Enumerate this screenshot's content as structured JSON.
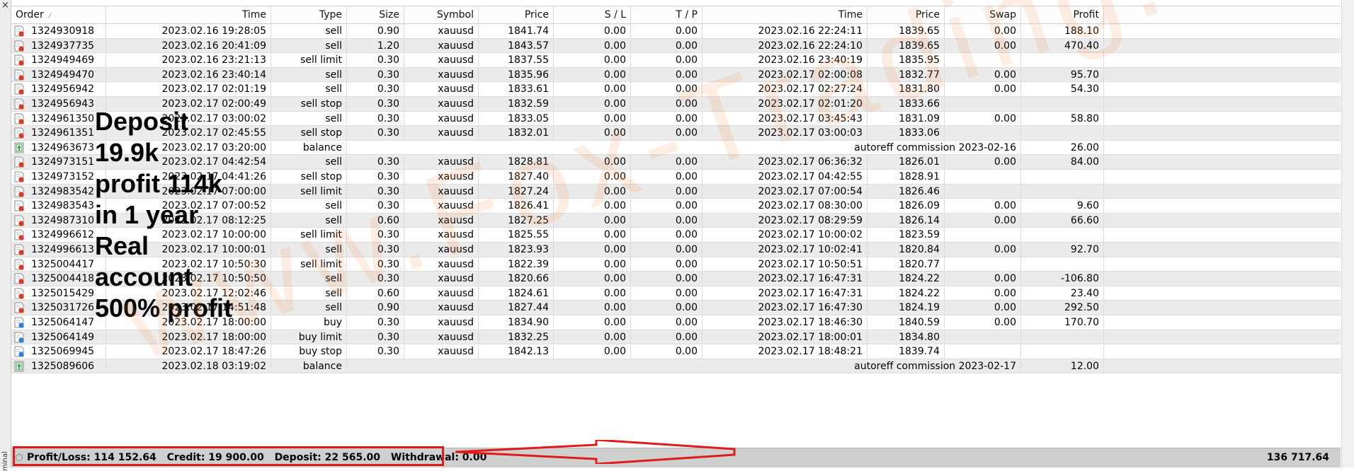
{
  "window": {
    "close_glyph": "×",
    "side_label": "minal"
  },
  "columns": [
    "Order",
    "Time",
    "Type",
    "Size",
    "Symbol",
    "Price",
    "S / L",
    "T / P",
    "Time",
    "Price",
    "Swap",
    "Profit"
  ],
  "rows": [
    {
      "order": "1324930918",
      "icon": "sell-order-icon",
      "time": "2023.02.16 19:28:05",
      "type": "sell",
      "size": "0.90",
      "symbol": "xauusd",
      "price": "1841.74",
      "sl": "0.00",
      "tp": "0.00",
      "close_time": "2023.02.16 22:24:11",
      "close_price": "1839.65",
      "swap": "0.00",
      "profit": "188.10"
    },
    {
      "order": "1324937735",
      "icon": "sell-order-icon",
      "time": "2023.02.16 20:41:09",
      "type": "sell",
      "size": "1.20",
      "symbol": "xauusd",
      "price": "1843.57",
      "sl": "0.00",
      "tp": "0.00",
      "close_time": "2023.02.16 22:24:10",
      "close_price": "1839.65",
      "swap": "0.00",
      "profit": "470.40"
    },
    {
      "order": "1324949469",
      "icon": "sell-order-icon",
      "time": "2023.02.16 23:21:13",
      "type": "sell limit",
      "size": "0.30",
      "symbol": "xauusd",
      "price": "1837.55",
      "sl": "0.00",
      "tp": "0.00",
      "close_time": "2023.02.16 23:40:19",
      "close_price": "1835.95",
      "swap": "",
      "profit": ""
    },
    {
      "order": "1324949470",
      "icon": "sell-order-icon",
      "time": "2023.02.16 23:40:14",
      "type": "sell",
      "size": "0.30",
      "symbol": "xauusd",
      "price": "1835.96",
      "sl": "0.00",
      "tp": "0.00",
      "close_time": "2023.02.17 02:00:08",
      "close_price": "1832.77",
      "swap": "0.00",
      "profit": "95.70"
    },
    {
      "order": "1324956942",
      "icon": "sell-order-icon",
      "time": "2023.02.17 02:01:19",
      "type": "sell",
      "size": "0.30",
      "symbol": "xauusd",
      "price": "1833.61",
      "sl": "0.00",
      "tp": "0.00",
      "close_time": "2023.02.17 02:27:24",
      "close_price": "1831.80",
      "swap": "0.00",
      "profit": "54.30"
    },
    {
      "order": "1324956943",
      "icon": "sell-order-icon",
      "time": "2023.02.17 02:00:49",
      "type": "sell stop",
      "size": "0.30",
      "symbol": "xauusd",
      "price": "1832.59",
      "sl": "0.00",
      "tp": "0.00",
      "close_time": "2023.02.17 02:01:20",
      "close_price": "1833.66",
      "swap": "",
      "profit": ""
    },
    {
      "order": "1324961350",
      "icon": "sell-order-icon",
      "time": "2023.02.17 03:00:02",
      "type": "sell",
      "size": "0.30",
      "symbol": "xauusd",
      "price": "1833.05",
      "sl": "0.00",
      "tp": "0.00",
      "close_time": "2023.02.17 03:45:43",
      "close_price": "1831.09",
      "swap": "0.00",
      "profit": "58.80"
    },
    {
      "order": "1324961351",
      "icon": "sell-order-icon",
      "time": "2023.02.17 02:45:55",
      "type": "sell stop",
      "size": "0.30",
      "symbol": "xauusd",
      "price": "1832.01",
      "sl": "0.00",
      "tp": "0.00",
      "close_time": "2023.02.17 03:00:03",
      "close_price": "1833.06",
      "swap": "",
      "profit": ""
    },
    {
      "order": "1324963673",
      "icon": "balance-icon",
      "time": "2023.02.17 03:20:00",
      "type": "balance",
      "comment": "autoreff commission 2023-02-16",
      "profit": "26.00"
    },
    {
      "order": "1324973151",
      "icon": "sell-order-icon",
      "time": "2023.02.17 04:42:54",
      "type": "sell",
      "size": "0.30",
      "symbol": "xauusd",
      "price": "1828.81",
      "sl": "0.00",
      "tp": "0.00",
      "close_time": "2023.02.17 06:36:32",
      "close_price": "1826.01",
      "swap": "0.00",
      "profit": "84.00"
    },
    {
      "order": "1324973152",
      "icon": "sell-order-icon",
      "time": "2023.02.17 04:41:26",
      "type": "sell stop",
      "size": "0.30",
      "symbol": "xauusd",
      "price": "1827.40",
      "sl": "0.00",
      "tp": "0.00",
      "close_time": "2023.02.17 04:42:55",
      "close_price": "1828.91",
      "swap": "",
      "profit": ""
    },
    {
      "order": "1324983542",
      "icon": "sell-order-icon",
      "time": "2023.02.17 07:00:00",
      "type": "sell limit",
      "size": "0.30",
      "symbol": "xauusd",
      "price": "1827.24",
      "sl": "0.00",
      "tp": "0.00",
      "close_time": "2023.02.17 07:00:54",
      "close_price": "1826.46",
      "swap": "",
      "profit": ""
    },
    {
      "order": "1324983543",
      "icon": "sell-order-icon",
      "time": "2023.02.17 07:00:52",
      "type": "sell",
      "size": "0.30",
      "symbol": "xauusd",
      "price": "1826.41",
      "sl": "0.00",
      "tp": "0.00",
      "close_time": "2023.02.17 08:30:00",
      "close_price": "1826.09",
      "swap": "0.00",
      "profit": "9.60"
    },
    {
      "order": "1324987310",
      "icon": "sell-order-icon",
      "time": "2023.02.17 08:12:25",
      "type": "sell",
      "size": "0.60",
      "symbol": "xauusd",
      "price": "1827.25",
      "sl": "0.00",
      "tp": "0.00",
      "close_time": "2023.02.17 08:29:59",
      "close_price": "1826.14",
      "swap": "0.00",
      "profit": "66.60"
    },
    {
      "order": "1324996612",
      "icon": "sell-order-icon",
      "time": "2023.02.17 10:00:00",
      "type": "sell limit",
      "size": "0.30",
      "symbol": "xauusd",
      "price": "1825.55",
      "sl": "0.00",
      "tp": "0.00",
      "close_time": "2023.02.17 10:00:02",
      "close_price": "1823.59",
      "swap": "",
      "profit": ""
    },
    {
      "order": "1324996613",
      "icon": "sell-order-icon",
      "time": "2023.02.17 10:00:01",
      "type": "sell",
      "size": "0.30",
      "symbol": "xauusd",
      "price": "1823.93",
      "sl": "0.00",
      "tp": "0.00",
      "close_time": "2023.02.17 10:02:41",
      "close_price": "1820.84",
      "swap": "0.00",
      "profit": "92.70"
    },
    {
      "order": "1325004417",
      "icon": "sell-order-icon",
      "time": "2023.02.17 10:50:30",
      "type": "sell limit",
      "size": "0.30",
      "symbol": "xauusd",
      "price": "1822.39",
      "sl": "0.00",
      "tp": "0.00",
      "close_time": "2023.02.17 10:50:51",
      "close_price": "1820.77",
      "swap": "",
      "profit": ""
    },
    {
      "order": "1325004418",
      "icon": "sell-order-icon",
      "time": "2023.02.17 10:50:50",
      "type": "sell",
      "size": "0.30",
      "symbol": "xauusd",
      "price": "1820.66",
      "sl": "0.00",
      "tp": "0.00",
      "close_time": "2023.02.17 16:47:31",
      "close_price": "1824.22",
      "swap": "0.00",
      "profit": "-106.80"
    },
    {
      "order": "1325015429",
      "icon": "sell-order-icon",
      "time": "2023.02.17 12:02:46",
      "type": "sell",
      "size": "0.60",
      "symbol": "xauusd",
      "price": "1824.61",
      "sl": "0.00",
      "tp": "0.00",
      "close_time": "2023.02.17 16:47:31",
      "close_price": "1824.22",
      "swap": "0.00",
      "profit": "23.40"
    },
    {
      "order": "1325031726",
      "icon": "sell-order-icon",
      "time": "2023.02.17 14:51:48",
      "type": "sell",
      "size": "0.90",
      "symbol": "xauusd",
      "price": "1827.44",
      "sl": "0.00",
      "tp": "0.00",
      "close_time": "2023.02.17 16:47:30",
      "close_price": "1824.19",
      "swap": "0.00",
      "profit": "292.50"
    },
    {
      "order": "1325064147",
      "icon": "buy-order-icon",
      "time": "2023.02.17 18:00:00",
      "type": "buy",
      "size": "0.30",
      "symbol": "xauusd",
      "price": "1834.90",
      "sl": "0.00",
      "tp": "0.00",
      "close_time": "2023.02.17 18:46:30",
      "close_price": "1840.59",
      "swap": "0.00",
      "profit": "170.70"
    },
    {
      "order": "1325064149",
      "icon": "buy-order-icon",
      "time": "2023.02.17 18:00:00",
      "type": "buy limit",
      "size": "0.30",
      "symbol": "xauusd",
      "price": "1832.25",
      "sl": "0.00",
      "tp": "0.00",
      "close_time": "2023.02.17 18:00:01",
      "close_price": "1834.80",
      "swap": "",
      "profit": ""
    },
    {
      "order": "1325069945",
      "icon": "buy-order-icon",
      "time": "2023.02.17 18:47:26",
      "type": "buy stop",
      "size": "0.30",
      "symbol": "xauusd",
      "price": "1842.13",
      "sl": "0.00",
      "tp": "0.00",
      "close_time": "2023.02.17 18:48:21",
      "close_price": "1839.74",
      "swap": "",
      "profit": ""
    },
    {
      "order": "1325089606",
      "icon": "balance-icon",
      "time": "2023.02.18 03:19:02",
      "type": "balance",
      "comment": "autoreff commission 2023-02-17",
      "profit": "12.00"
    }
  ],
  "footer": {
    "profit_loss": "Profit/Loss: 114 152.64",
    "credit": "Credit: 19 900.00",
    "deposit": "Deposit: 22 565.00",
    "withdrawal": "Withdrawal: 0.00",
    "total": "136 717.64"
  },
  "overlay_text": [
    "Deposit",
    "19.9k",
    "profit 114k",
    "in 1 year",
    "Real",
    "account",
    "500% profit"
  ],
  "watermark": "www.Fox-Trading.com",
  "colors": {
    "highlight_box": "#e01a1a",
    "arrow": "#e01a1a",
    "watermark": "#f08c50",
    "sell_icon": "#d63b2a",
    "buy_icon": "#2f7fd6",
    "balance_icon": "#2ea043"
  }
}
